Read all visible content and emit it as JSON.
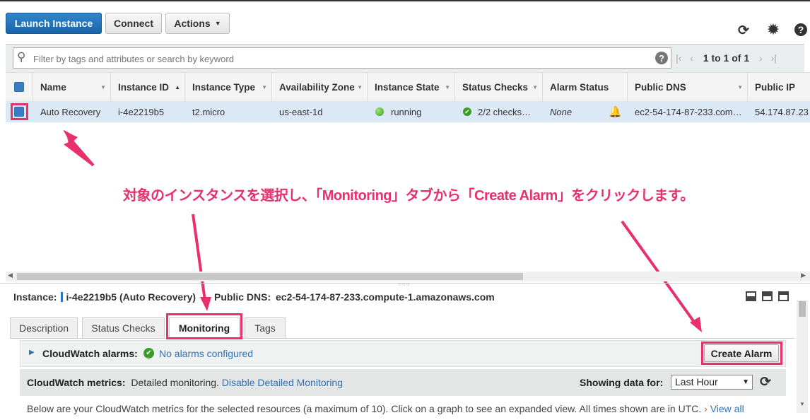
{
  "toolbar": {
    "launch_label": "Launch Instance",
    "connect_label": "Connect",
    "actions_label": "Actions",
    "refresh_icon": "refresh-icon",
    "settings_icon": "gear-icon",
    "help_icon": "help-icon"
  },
  "search": {
    "placeholder": "Filter by tags and attributes or search by keyword",
    "help_glyph": "?"
  },
  "pagination": {
    "text": "1 to 1 of 1"
  },
  "table": {
    "columns": [
      "Name",
      "Instance ID",
      "Instance Type",
      "Availability Zone",
      "Instance State",
      "Status Checks",
      "Alarm Status",
      "Public DNS",
      "Public IP"
    ],
    "rows": [
      {
        "name": "Auto Recovery",
        "instance_id": "i-4e2219b5",
        "instance_type": "t2.micro",
        "availability_zone": "us-east-1d",
        "instance_state": "running",
        "status_checks": "2/2 checks…",
        "alarm_status": "None",
        "public_dns": "ec2-54-174-87-233.com…",
        "public_ip": "54.174.87.23"
      }
    ]
  },
  "annotation": {
    "text": "対象のインスタンスを選択し、「Monitoring」タブから「Create Alarm」をクリックします。",
    "color": "#e8306d"
  },
  "details": {
    "instance_label": "Instance:",
    "instance_value": "i-4e2219b5 (Auto Recovery)",
    "dns_label": "Public DNS:",
    "dns_value": "ec2-54-174-87-233.compute-1.amazonaws.com"
  },
  "tabs": [
    "Description",
    "Status Checks",
    "Monitoring",
    "Tags"
  ],
  "active_tab": "Monitoring",
  "cloudwatch": {
    "alarms_label": "CloudWatch alarms:",
    "alarms_value": "No alarms configured",
    "create_alarm_label": "Create Alarm",
    "metrics_label": "CloudWatch metrics:",
    "metrics_value": "Detailed monitoring.",
    "disable_link": "Disable Detailed Monitoring",
    "showing_label": "Showing data for:",
    "showing_value": "Last Hour",
    "note": "Below are your CloudWatch metrics for the selected resources (a maximum of 10). Click on a graph to see an expanded view. All times shown are in UTC.",
    "view_all": "View all"
  },
  "colors": {
    "primary": "#1b64a9",
    "link": "#2e73b8",
    "highlight": "#e8306d",
    "selected_row": "#dbe8f5",
    "running": "#3a9c12"
  }
}
